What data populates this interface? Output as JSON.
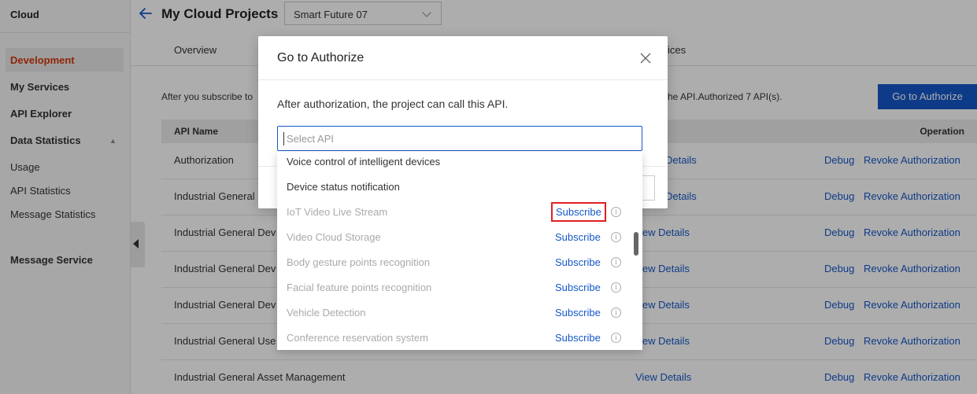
{
  "sidebar": {
    "brand": "Cloud",
    "items": [
      {
        "label": "Development"
      },
      {
        "label": "My Services"
      },
      {
        "label": "API Explorer"
      },
      {
        "label": "Data Statistics"
      },
      {
        "label": "Usage"
      },
      {
        "label": "API Statistics"
      },
      {
        "label": "Message Statistics"
      },
      {
        "label": "Message Service"
      }
    ]
  },
  "header": {
    "title": "My Cloud Projects",
    "project": "Smart Future 07"
  },
  "tabs": [
    {
      "label": "Overview"
    },
    {
      "label": "ices"
    }
  ],
  "notice": {
    "left": "After you subscribe to",
    "right": "he API.Authorized 7 API(s)."
  },
  "actions": {
    "go_to_authorize": "Go to Authorize"
  },
  "table": {
    "col_name": "API Name",
    "col_operation": "Operation",
    "view_label": "View Details",
    "debug_label": "Debug",
    "revoke_label": "Revoke Authorization",
    "rows": [
      {
        "name": "Authorization",
        "view": "Details"
      },
      {
        "name": "Industrial General",
        "view": "Details"
      },
      {
        "name": "Industrial General Dev",
        "view": "iew Details"
      },
      {
        "name": "Industrial General Dev",
        "view": "iew Details"
      },
      {
        "name": "Industrial General Dev",
        "view": "iew Details"
      },
      {
        "name": "Industrial General Use",
        "view": "iew Details"
      },
      {
        "name": "Industrial General Asset Management",
        "view": "View Details"
      }
    ]
  },
  "modal": {
    "title": "Go to Authorize",
    "description": "After authorization, the project can call this API.",
    "select_placeholder": "Select API",
    "subscribe_label": "Subscribe",
    "info_glyph": "i",
    "options": [
      {
        "label": "Voice control of intelligent devices",
        "enabled": true
      },
      {
        "label": "Device status notification",
        "enabled": true
      },
      {
        "label": "IoT Video Live Stream",
        "enabled": false,
        "highlighted": true
      },
      {
        "label": "Video Cloud Storage",
        "enabled": false
      },
      {
        "label": "Body gesture points recognition",
        "enabled": false
      },
      {
        "label": "Facial feature points recognition",
        "enabled": false
      },
      {
        "label": "Vehicle Detection",
        "enabled": false
      },
      {
        "label": "Conference reservation system",
        "enabled": false
      }
    ]
  },
  "colors": {
    "primary": "#1558c9",
    "active_nav": "#d4380d",
    "highlight_box": "#e02020"
  }
}
